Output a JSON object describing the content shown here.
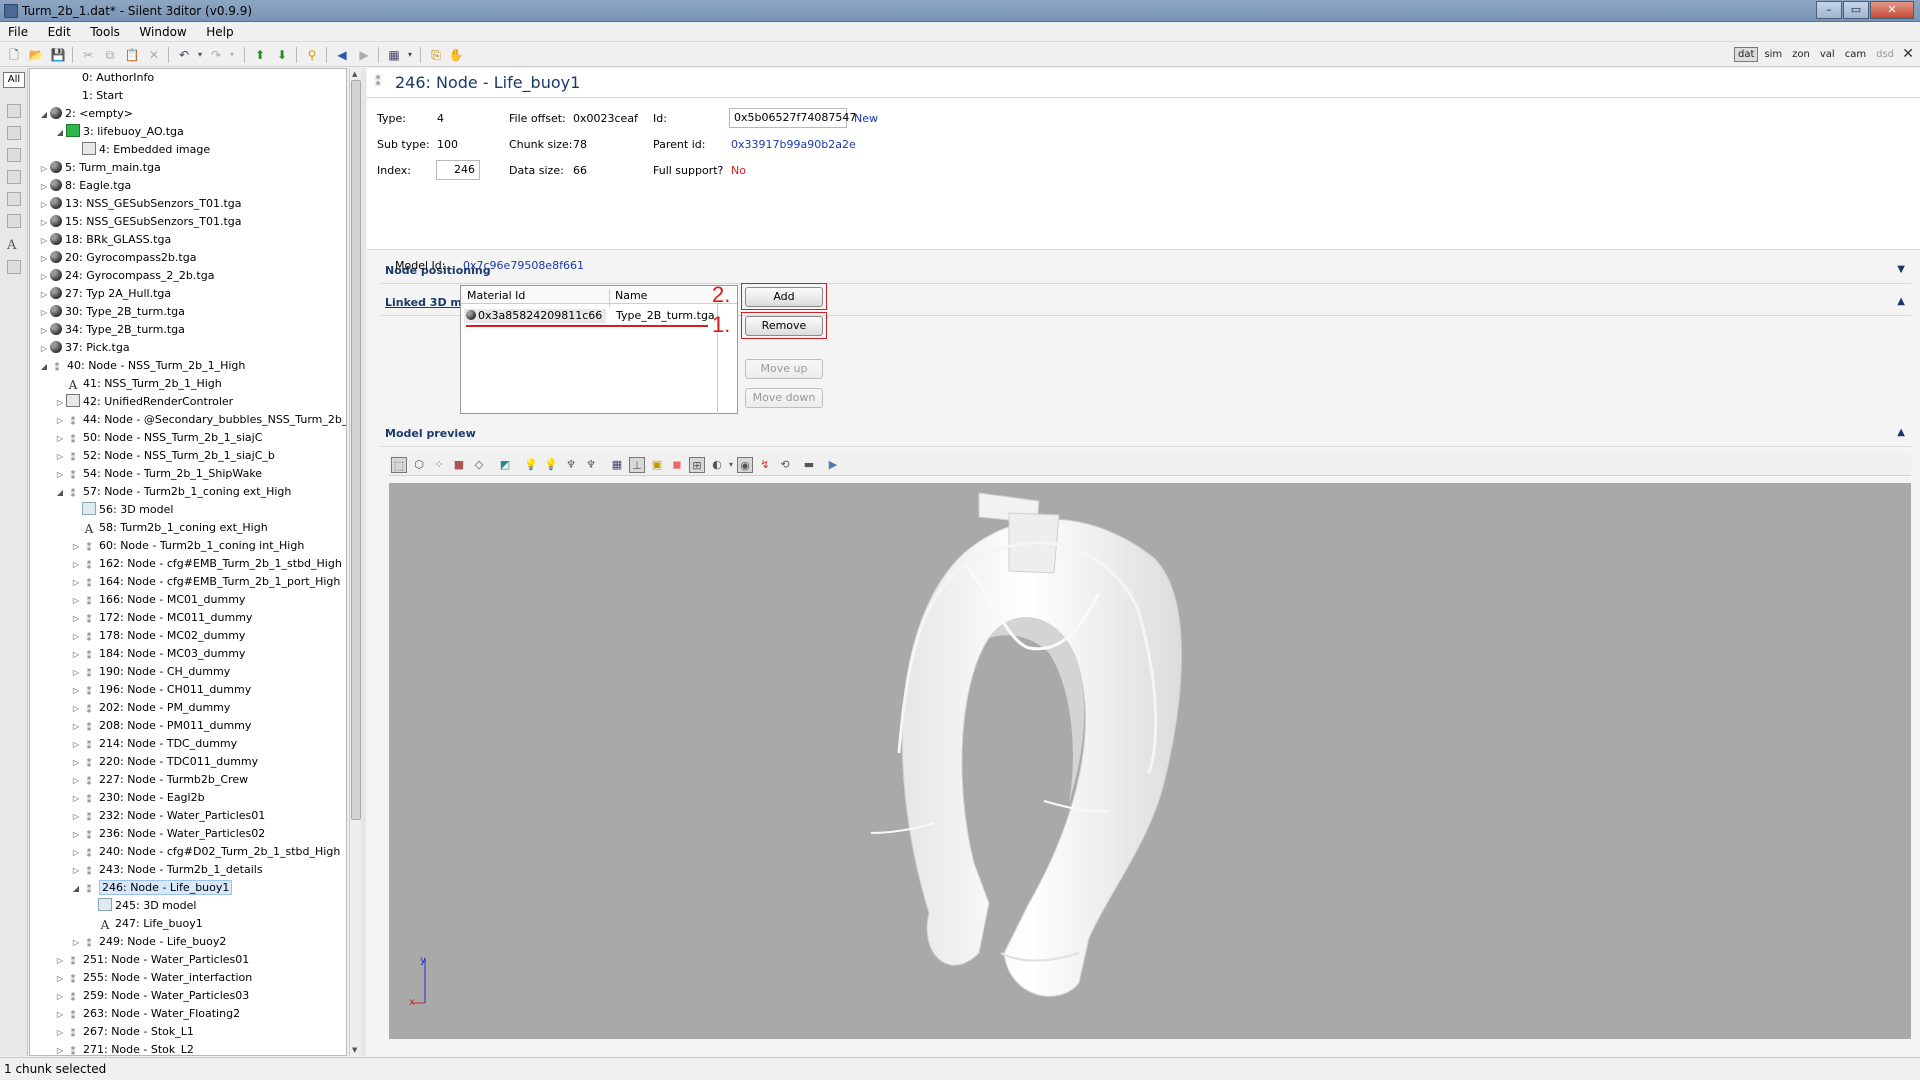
{
  "window": {
    "title": "Turm_2b_1.dat* - Silent 3ditor (v0.9.9)"
  },
  "menu": [
    "File",
    "Edit",
    "Tools",
    "Window",
    "Help"
  ],
  "modes": [
    "dat",
    "sim",
    "zon",
    "val",
    "cam",
    "dsd"
  ],
  "left_strip": {
    "all_label": "All"
  },
  "tree": [
    {
      "label": "0: AuthorInfo",
      "level": 2,
      "exp": "",
      "icon": ""
    },
    {
      "label": "1: Start",
      "level": 2,
      "exp": "",
      "icon": ""
    },
    {
      "label": "2: <empty>",
      "level": 0,
      "exp": "open",
      "icon": "ball"
    },
    {
      "label": "3: lifebuoy_AO.tga",
      "level": 1,
      "exp": "open",
      "icon": "green"
    },
    {
      "label": "4: Embedded image",
      "level": 2,
      "exp": "",
      "icon": "img"
    },
    {
      "label": "5: Turm_main.tga",
      "level": 0,
      "exp": "closed",
      "icon": "ball"
    },
    {
      "label": "8: Eagle.tga",
      "level": 0,
      "exp": "closed",
      "icon": "ball"
    },
    {
      "label": "13: NSS_GESubSenzors_T01.tga",
      "level": 0,
      "exp": "closed",
      "icon": "ball"
    },
    {
      "label": "15: NSS_GESubSenzors_T01.tga",
      "level": 0,
      "exp": "closed",
      "icon": "ball"
    },
    {
      "label": "18: BRk_GLASS.tga",
      "level": 0,
      "exp": "closed",
      "icon": "ball"
    },
    {
      "label": "20: Gyrocompass2b.tga",
      "level": 0,
      "exp": "closed",
      "icon": "ball"
    },
    {
      "label": "24: Gyrocompass_2_2b.tga",
      "level": 0,
      "exp": "closed",
      "icon": "ball"
    },
    {
      "label": "27: Typ 2A_Hull.tga",
      "level": 0,
      "exp": "closed",
      "icon": "ball"
    },
    {
      "label": "30: Type_2B_turm.tga",
      "level": 0,
      "exp": "closed",
      "icon": "ball"
    },
    {
      "label": "34: Type_2B_turm.tga",
      "level": 0,
      "exp": "closed",
      "icon": "ball"
    },
    {
      "label": "37: Pick.tga",
      "level": 0,
      "exp": "closed",
      "icon": "ball"
    },
    {
      "label": "40: Node - NSS_Turm_2b_1_High",
      "level": 0,
      "exp": "open",
      "icon": "node"
    },
    {
      "label": "41: NSS_Turm_2b_1_High",
      "level": 1,
      "exp": "",
      "icon": "txt"
    },
    {
      "label": "42: UnifiedRenderControler",
      "level": 1,
      "exp": "closed",
      "icon": "img"
    },
    {
      "label": "44: Node - @Secondary_bubbles_NSS_Turm_2b_1",
      "level": 1,
      "exp": "closed",
      "icon": "node"
    },
    {
      "label": "50: Node - NSS_Turm_2b_1_siajC",
      "level": 1,
      "exp": "closed",
      "icon": "node"
    },
    {
      "label": "52: Node - NSS_Turm_2b_1_siajC_b",
      "level": 1,
      "exp": "closed",
      "icon": "node"
    },
    {
      "label": "54: Node - Turm_2b_1_ShipWake",
      "level": 1,
      "exp": "closed",
      "icon": "node"
    },
    {
      "label": "57: Node - Turm2b_1_coning ext_High",
      "level": 1,
      "exp": "open",
      "icon": "node"
    },
    {
      "label": "56: 3D model",
      "level": 2,
      "exp": "",
      "icon": "box"
    },
    {
      "label": "58: Turm2b_1_coning ext_High",
      "level": 2,
      "exp": "",
      "icon": "txt"
    },
    {
      "label": "60: Node - Turm2b_1_coning int_High",
      "level": 2,
      "exp": "closed",
      "icon": "node"
    },
    {
      "label": "162: Node - cfg#EMB_Turm_2b_1_stbd_High",
      "level": 2,
      "exp": "closed",
      "icon": "node"
    },
    {
      "label": "164: Node - cfg#EMB_Turm_2b_1_port_High",
      "level": 2,
      "exp": "closed",
      "icon": "node"
    },
    {
      "label": "166: Node - MC01_dummy",
      "level": 2,
      "exp": "closed",
      "icon": "node"
    },
    {
      "label": "172: Node - MC011_dummy",
      "level": 2,
      "exp": "closed",
      "icon": "node"
    },
    {
      "label": "178: Node - MC02_dummy",
      "level": 2,
      "exp": "closed",
      "icon": "node"
    },
    {
      "label": "184: Node - MC03_dummy",
      "level": 2,
      "exp": "closed",
      "icon": "node"
    },
    {
      "label": "190: Node - CH_dummy",
      "level": 2,
      "exp": "closed",
      "icon": "node"
    },
    {
      "label": "196: Node - CH011_dummy",
      "level": 2,
      "exp": "closed",
      "icon": "node"
    },
    {
      "label": "202: Node - PM_dummy",
      "level": 2,
      "exp": "closed",
      "icon": "node"
    },
    {
      "label": "208: Node - PM011_dummy",
      "level": 2,
      "exp": "closed",
      "icon": "node"
    },
    {
      "label": "214: Node - TDC_dummy",
      "level": 2,
      "exp": "closed",
      "icon": "node"
    },
    {
      "label": "220: Node - TDC011_dummy",
      "level": 2,
      "exp": "closed",
      "icon": "node"
    },
    {
      "label": "227: Node - Turmb2b_Crew",
      "level": 2,
      "exp": "closed",
      "icon": "node"
    },
    {
      "label": "230: Node - Eagl2b",
      "level": 2,
      "exp": "closed",
      "icon": "node"
    },
    {
      "label": "232: Node - Water_Particles01",
      "level": 2,
      "exp": "closed",
      "icon": "node"
    },
    {
      "label": "236: Node - Water_Particles02",
      "level": 2,
      "exp": "closed",
      "icon": "node"
    },
    {
      "label": "240: Node - cfg#D02_Turm_2b_1_stbd_High",
      "level": 2,
      "exp": "closed",
      "icon": "node"
    },
    {
      "label": "243: Node - Turm2b_1_details",
      "level": 2,
      "exp": "closed",
      "icon": "node"
    },
    {
      "label": "246: Node - Life_buoy1",
      "level": 2,
      "exp": "open",
      "icon": "node",
      "selected": true
    },
    {
      "label": "245: 3D model",
      "level": 3,
      "exp": "",
      "icon": "box"
    },
    {
      "label": "247: Life_buoy1",
      "level": 3,
      "exp": "",
      "icon": "txt"
    },
    {
      "label": "249: Node - Life_buoy2",
      "level": 2,
      "exp": "closed",
      "icon": "node"
    },
    {
      "label": "251: Node - Water_Particles01",
      "level": 1,
      "exp": "closed",
      "icon": "node"
    },
    {
      "label": "255: Node - Water_interfaction",
      "level": 1,
      "exp": "closed",
      "icon": "node"
    },
    {
      "label": "259: Node - Water_Particles03",
      "level": 1,
      "exp": "closed",
      "icon": "node"
    },
    {
      "label": "263: Node - Water_Floating2",
      "level": 1,
      "exp": "closed",
      "icon": "node"
    },
    {
      "label": "267: Node - Stok_L1",
      "level": 1,
      "exp": "closed",
      "icon": "node"
    },
    {
      "label": "271: Node - Stok_L2",
      "level": 1,
      "exp": "closed",
      "icon": "node"
    }
  ],
  "panel": {
    "title": "246: Node - Life_buoy1",
    "type_label": "Type:",
    "type_value": "4",
    "subtype_label": "Sub type:",
    "subtype_value": "100",
    "index_label": "Index:",
    "index_value": "246",
    "file_offset_label": "File offset:",
    "file_offset_value": "0x0023ceaf",
    "chunk_size_label": "Chunk size:",
    "chunk_size_value": "78",
    "data_size_label": "Data size:",
    "data_size_value": "66",
    "id_label": "Id:",
    "id_value": "0x5b06527f74087547",
    "id_new": "New",
    "parent_id_label": "Parent id:",
    "parent_id_value": "0x33917b99a90b2a2e",
    "full_support_label": "Full support?",
    "full_support_value": "No"
  },
  "sections": {
    "node_positioning": "Node positioning",
    "linked_3d_model": "Linked 3D model",
    "model_preview": "Model preview"
  },
  "linked_model": {
    "model_id_label": "Model Id:",
    "model_id_value": "0x7c96e79508e8f661",
    "columns": [
      "Material Id",
      "Name"
    ],
    "row": {
      "material_id": "0x3a85824209811c66",
      "name": "Type_2B_turm.tga"
    }
  },
  "buttons": {
    "add": "Add",
    "remove": "Remove",
    "move_up": "Move up",
    "move_down": "Move down"
  },
  "annotations": {
    "one": "1.",
    "two": "2."
  },
  "axes": {
    "x": "x",
    "y": "y"
  },
  "status": "1 chunk selected",
  "colors": {
    "annotation_red": "#d02020",
    "link_blue": "#1a3aa8",
    "viewport_bg": "#a9a9a9",
    "model_white": "#f4f4f4"
  }
}
